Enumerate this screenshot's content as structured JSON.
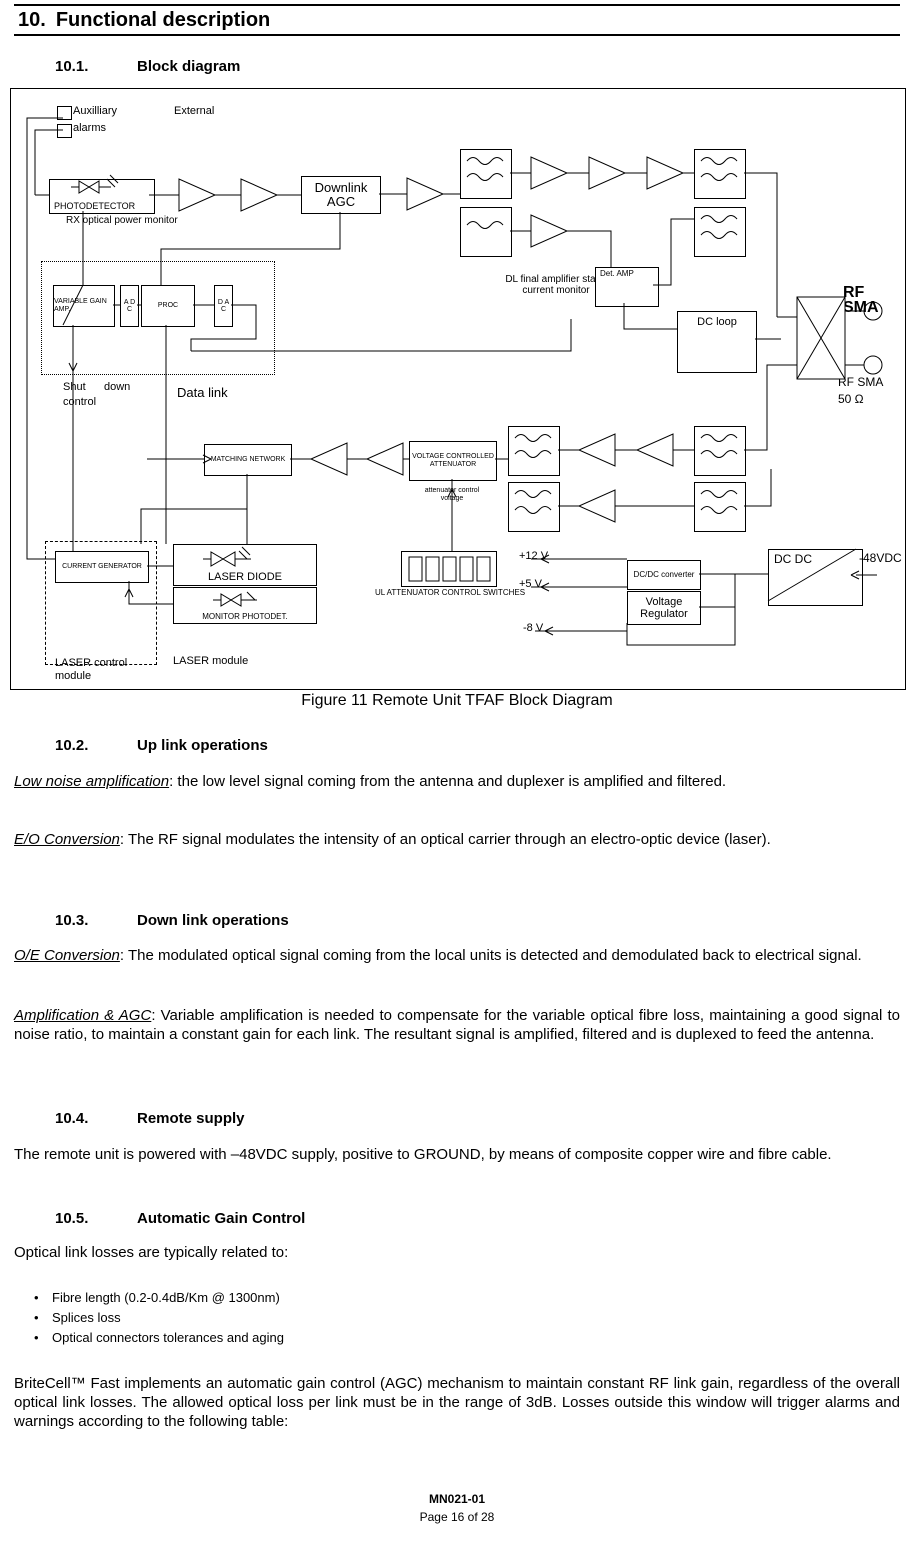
{
  "heading": {
    "number": "10.",
    "title": "Functional description"
  },
  "sections": {
    "s1": {
      "number": "10.1.",
      "title": "Block diagram"
    },
    "s2": {
      "number": "10.2.",
      "title": "Up link operations"
    },
    "s3": {
      "number": "10.3.",
      "title": "Down link operations"
    },
    "s4": {
      "number": "10.4.",
      "title": "Remote supply"
    },
    "s5": {
      "number": "10.5.",
      "title": "Automatic Gain Control"
    }
  },
  "figure": {
    "caption": "Figure 11  Remote Unit TFAF Block Diagram",
    "labels": {
      "auxilliary": "Auxilliary",
      "external": "External",
      "alarms": "alarms",
      "photodetector": "PHOTODETECTOR",
      "rx_monitor": "RX optical power monitor",
      "downlink": "Downlink",
      "agc": "AGC",
      "dl_final_1": "DL final amplifier stage",
      "dl_final_2": "current monitor",
      "det_amp": "Det. AMP",
      "dc_loop": "DC loop",
      "variable_gain_amp": "VARIABLE GAIN AMP.",
      "adc": "A D C",
      "proc": "PROC",
      "dac": "D A C",
      "shutdown_1": "Shut      down",
      "shutdown_2": "control",
      "data_link": "Data link",
      "rf_sma_top": "RF SMA",
      "rf_sma_bottom": "RF SMA",
      "impedance": "50 Ω",
      "matching_network": "MATCHING NETWORK",
      "vca": "VOLTAGE CONTROLLED ATTENUATOR",
      "atten_ctrl_voltage": "attenuator control voltage",
      "current_generator": "CURRENT GENERATOR",
      "laser_diode": "LASER DIODE",
      "monitor_photodet": "MONITOR PHOTODET.",
      "laser_control_module": "LASER control module",
      "laser_module": "LASER module",
      "ul_atten_switches": "UL  ATTENUATOR CONTROL SWITCHES",
      "v12": "+12 V",
      "v5": "+5 V",
      "v8": "-8 V",
      "dcdc": "DC/DC converter",
      "voltage_regulator": "Voltage Regulator",
      "dc_dc_block": "DC     DC",
      "supply_48": "-48VDC"
    }
  },
  "body": {
    "p1_lead": "Low  noise  amplification",
    "p1": ": the low level signal coming from the antenna and duplexer is amplified and filtered.",
    "p2_lead": "E/O  Conversion",
    "p2": ": The RF signal modulates the intensity of an optical carrier through an electro-optic device (laser).",
    "p3_lead": "O/E  Conversion",
    "p3": ": The modulated optical signal coming from the local units is detected and demodulated back to electrical signal.",
    "p4_lead": "Amplification  &  AGC",
    "p4": ": Variable amplification is needed to compensate for the variable optical fibre loss, maintaining a good signal to noise ratio, to maintain a constant gain for each link. The resultant signal is amplified, filtered and is duplexed to feed the antenna.",
    "p5": "The remote unit is powered with  –48VDC supply, positive to GROUND, by means of composite copper wire and fibre cable.",
    "p6": "Optical link losses are typically related to:",
    "bullets": [
      "Fibre length (0.2-0.4dB/Km @ 1300nm)",
      "Splices loss",
      "Optical connectors tolerances and aging"
    ],
    "p7": "BriteCell™ Fast implements an automatic gain control (AGC) mechanism to maintain constant RF link gain, regardless of the overall optical link losses.  The allowed optical loss per link must be in the range of 3dB.  Losses outside this window will trigger alarms and warnings according to the following table:"
  },
  "footer": {
    "doc": "MN021-01",
    "page": "Page 16  of 28"
  }
}
